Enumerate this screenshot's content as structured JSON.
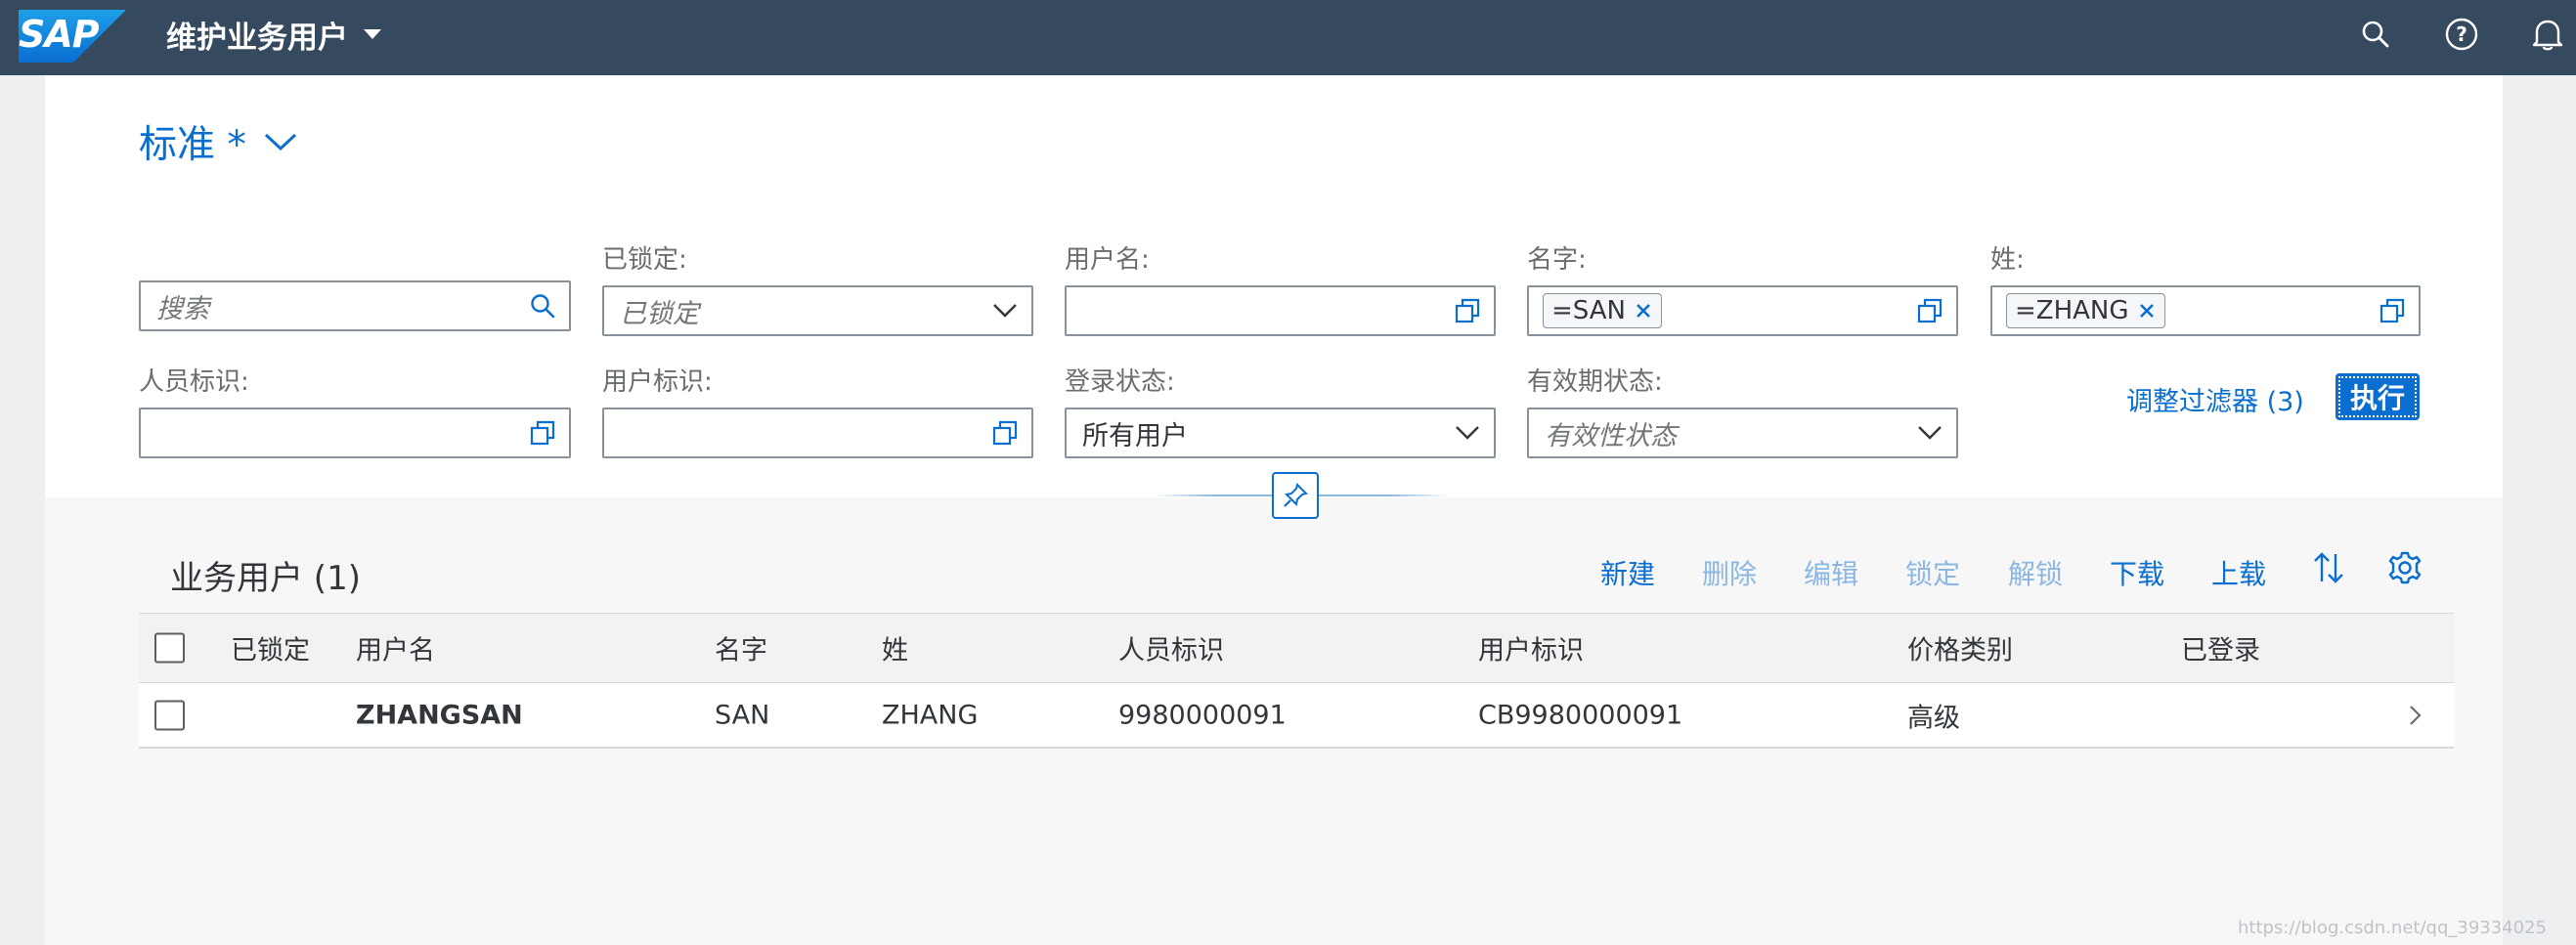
{
  "shell": {
    "logo_text": "SAP",
    "app_title": "维护业务用户",
    "icons": [
      "search-icon",
      "help-icon",
      "notifications-icon"
    ]
  },
  "variant": {
    "label": "标准 *"
  },
  "filters": {
    "search": {
      "placeholder": "搜索"
    },
    "locked": {
      "label": "已锁定:",
      "placeholder": "已锁定"
    },
    "username": {
      "label": "用户名:",
      "value": ""
    },
    "first_name": {
      "label": "名字:",
      "token": "=SAN"
    },
    "last_name": {
      "label": "姓:",
      "token": "=ZHANG"
    },
    "person_id": {
      "label": "人员标识:",
      "value": ""
    },
    "user_id": {
      "label": "用户标识:",
      "value": ""
    },
    "logon_status": {
      "label": "登录状态:",
      "value": "所有用户"
    },
    "validity_status": {
      "label": "有效期状态:",
      "placeholder": "有效性状态"
    },
    "adapt_filters": "调整过滤器 (3)",
    "go": "执行"
  },
  "table": {
    "title": "业务用户 (1)",
    "toolbar": {
      "create": "新建",
      "delete": "删除",
      "edit": "编辑",
      "lock": "锁定",
      "unlock": "解锁",
      "download": "下载",
      "upload": "上载"
    },
    "columns": [
      "已锁定",
      "用户名",
      "名字",
      "姓",
      "人员标识",
      "用户标识",
      "价格类别",
      "已登录"
    ],
    "rows": [
      {
        "locked": "",
        "username": "ZHANGSAN",
        "first_name": "SAN",
        "last_name": "ZHANG",
        "person_id": "9980000091",
        "user_id": "CB9980000091",
        "price_category": "高级",
        "logged_on": ""
      }
    ]
  },
  "watermark": "https://blog.csdn.net/qq_39334025",
  "colors": {
    "shell_bg": "#354a5f",
    "accent": "#0a6ed1",
    "disabled_action": "#8cb7e2"
  }
}
